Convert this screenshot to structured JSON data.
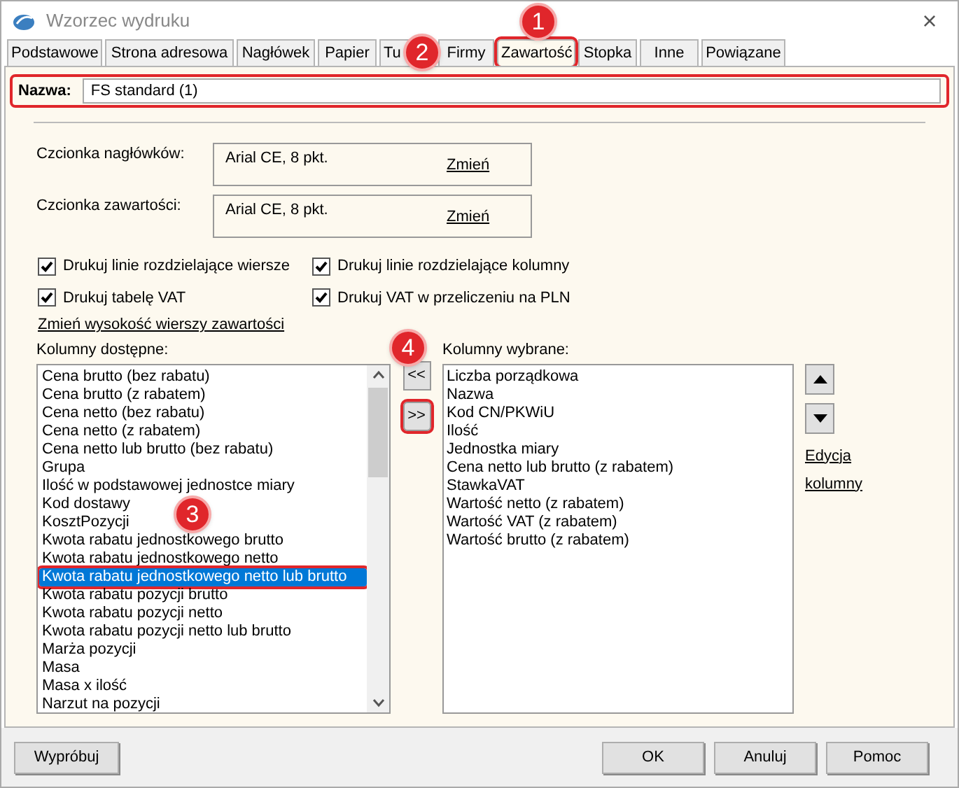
{
  "window": {
    "title": "Wzorzec wydruku",
    "close": "×"
  },
  "tabs": [
    {
      "label": "Podstawowe",
      "selected": false
    },
    {
      "label": "Strona adresowa",
      "selected": false
    },
    {
      "label": "Nagłówek",
      "selected": false
    },
    {
      "label": "Papier",
      "selected": false
    },
    {
      "label": "Tu",
      "selected": false
    },
    {
      "label": "Firmy",
      "selected": false
    },
    {
      "label": "Zawartość",
      "selected": true
    },
    {
      "label": "Stopka",
      "selected": false
    },
    {
      "label": "Inne",
      "selected": false
    },
    {
      "label": "Powiązane",
      "selected": false
    }
  ],
  "name_field": {
    "label": "Nazwa:",
    "value": "FS standard (1)"
  },
  "fonts": [
    {
      "label": "Czcionka nagłówków:",
      "value": "Arial CE, 8 pkt.",
      "link": "Zmień"
    },
    {
      "label": "Czcionka zawartości:",
      "value": "Arial CE, 8 pkt.",
      "link": "Zmień"
    }
  ],
  "checkboxes": [
    {
      "label": "Drukuj linie rozdzielające wiersze",
      "checked": true
    },
    {
      "label": "Drukuj linie rozdzielające kolumny",
      "checked": true
    },
    {
      "label": "Drukuj tabelę VAT",
      "checked": true
    },
    {
      "label": "Drukuj VAT w przeliczeniu na PLN",
      "checked": true
    }
  ],
  "row_height_link": "Zmień wysokość wierszy zawartości",
  "available": {
    "label": "Kolumny dostępne:",
    "items": [
      {
        "text": "Cena brutto (bez rabatu)",
        "selected": false
      },
      {
        "text": "Cena brutto (z rabatem)",
        "selected": false
      },
      {
        "text": "Cena netto (bez rabatu)",
        "selected": false
      },
      {
        "text": "Cena netto (z rabatem)",
        "selected": false
      },
      {
        "text": "Cena netto lub brutto (bez rabatu)",
        "selected": false
      },
      {
        "text": "Grupa",
        "selected": false
      },
      {
        "text": "Ilość w podstawowej jednostce miary",
        "selected": false
      },
      {
        "text": "Kod dostawy",
        "selected": false
      },
      {
        "text": "KosztPozycji",
        "selected": false
      },
      {
        "text": "Kwota rabatu jednostkowego brutto",
        "selected": false
      },
      {
        "text": "Kwota rabatu jednostkowego netto",
        "selected": false
      },
      {
        "text": "Kwota rabatu jednostkowego netto lub brutto",
        "selected": true
      },
      {
        "text": "Kwota rabatu pozycji brutto",
        "selected": false
      },
      {
        "text": "Kwota rabatu pozycji netto",
        "selected": false
      },
      {
        "text": "Kwota rabatu pozycji netto lub brutto",
        "selected": false
      },
      {
        "text": "Marża pozycji",
        "selected": false
      },
      {
        "text": "Masa",
        "selected": false
      },
      {
        "text": "Masa x ilość",
        "selected": false
      },
      {
        "text": "Narzut na pozycji",
        "selected": false
      }
    ]
  },
  "move_buttons": [
    "<<",
    ">>"
  ],
  "selected_columns": {
    "label": "Kolumny wybrane:",
    "items": [
      "Liczba porządkowa",
      "Nazwa",
      "Kod CN/PKWiU",
      "Ilość",
      "Jednostka miary",
      "Cena netto lub brutto (z rabatem)",
      "StawkaVAT",
      "Wartość netto (z rabatem)",
      "Wartość VAT (z rabatem)",
      "Wartość brutto (z rabatem)"
    ]
  },
  "edit_link": [
    "Edycja",
    "kolumny"
  ],
  "buttons": {
    "left": "Wypróbuj",
    "right": [
      "OK",
      "Anuluj",
      "Pomoc"
    ]
  },
  "annotations": [
    {
      "number": "1"
    },
    {
      "number": "2"
    },
    {
      "number": "3"
    },
    {
      "number": "4"
    }
  ]
}
